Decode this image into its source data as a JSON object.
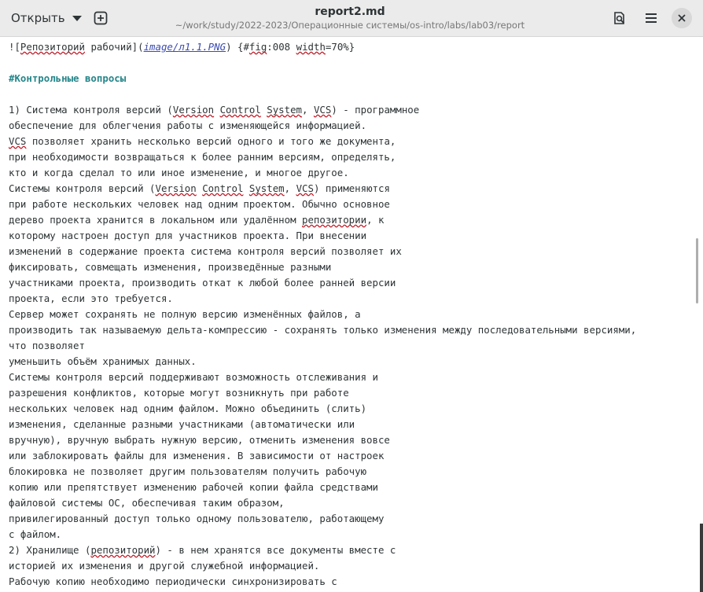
{
  "header": {
    "open_label": "Открыть",
    "new_tab_icon": "new-tab-plus-icon",
    "title": "report2.md",
    "path": "~/work/study/2022-2023/Операционные системы/os-intro/labs/lab03/report",
    "search_icon": "document-search-icon",
    "menu_icon": "hamburger-menu-icon",
    "close_icon": "close-icon"
  },
  "editor": {
    "lines": [
      {
        "segments": [
          {
            "t": "!["
          },
          {
            "t": "Репозиторий",
            "c": "sq"
          },
          {
            "t": " рабочий]("
          },
          {
            "t": "image",
            "c": "link"
          },
          {
            "t": "/",
            "c": "link"
          },
          {
            "t": "л1.1.PNG",
            "c": "link"
          },
          {
            "t": ") {#"
          },
          {
            "t": "fig",
            "c": "sq"
          },
          {
            "t": ":008 "
          },
          {
            "t": "width",
            "c": "sq"
          },
          {
            "t": "=70%}"
          }
        ]
      },
      {
        "segments": []
      },
      {
        "segments": [
          {
            "t": "#Контрольные вопросы",
            "c": "heading"
          }
        ]
      },
      {
        "segments": []
      },
      {
        "segments": [
          {
            "t": "1) Система контроля версий ("
          },
          {
            "t": "Version",
            "c": "sq"
          },
          {
            "t": " "
          },
          {
            "t": "Control",
            "c": "sq"
          },
          {
            "t": " "
          },
          {
            "t": "System",
            "c": "sq"
          },
          {
            "t": ", "
          },
          {
            "t": "VCS",
            "c": "sq"
          },
          {
            "t": ") - программное"
          }
        ]
      },
      {
        "segments": [
          {
            "t": "обеспечение для облегчения работы с изменяющейся информацией."
          }
        ]
      },
      {
        "segments": [
          {
            "t": "VCS",
            "c": "sq"
          },
          {
            "t": " позволяет хранить несколько версий одного и того же документа,"
          }
        ]
      },
      {
        "segments": [
          {
            "t": "при необходимости возвращаться к более ранним версиям, определять,"
          }
        ]
      },
      {
        "segments": [
          {
            "t": "кто и когда сделал то или иное изменение, и многое другое."
          }
        ]
      },
      {
        "segments": [
          {
            "t": "Системы контроля версий ("
          },
          {
            "t": "Version",
            "c": "sq"
          },
          {
            "t": " "
          },
          {
            "t": "Control",
            "c": "sq"
          },
          {
            "t": " "
          },
          {
            "t": "System",
            "c": "sq"
          },
          {
            "t": ", "
          },
          {
            "t": "VCS",
            "c": "sq"
          },
          {
            "t": ") применяются"
          }
        ]
      },
      {
        "segments": [
          {
            "t": "при работе нескольких человек над одним проектом. Обычно основное"
          }
        ]
      },
      {
        "segments": [
          {
            "t": "дерево проекта хранится в локальном или удалённом "
          },
          {
            "t": "репозитории",
            "c": "sq"
          },
          {
            "t": ", к"
          }
        ]
      },
      {
        "segments": [
          {
            "t": "которому настроен доступ для участников проекта. При внесении"
          }
        ]
      },
      {
        "segments": [
          {
            "t": "изменений в содержание проекта система контроля версий позволяет их"
          }
        ]
      },
      {
        "segments": [
          {
            "t": "фиксировать, совмещать изменения, произведённые разными"
          }
        ]
      },
      {
        "segments": [
          {
            "t": "участниками проекта, производить откат к любой более ранней версии"
          }
        ]
      },
      {
        "segments": [
          {
            "t": "проекта, если это требуется."
          }
        ]
      },
      {
        "segments": [
          {
            "t": "Сервер может сохранять не полную версию изменённых файлов, а"
          }
        ]
      },
      {
        "segments": [
          {
            "t": "производить так называемую дельта-компрессию - сохранять только изменения между последовательными версиями,"
          }
        ]
      },
      {
        "segments": [
          {
            "t": "что позволяет"
          }
        ]
      },
      {
        "segments": [
          {
            "t": "уменьшить объём хранимых данных."
          }
        ]
      },
      {
        "segments": [
          {
            "t": "Системы контроля версий поддерживают возможность отслеживания и"
          }
        ]
      },
      {
        "segments": [
          {
            "t": "разрешения конфликтов, которые могут возникнуть при работе"
          }
        ]
      },
      {
        "segments": [
          {
            "t": "нескольких человек над одним файлом. Можно объединить (слить)"
          }
        ]
      },
      {
        "segments": [
          {
            "t": "изменения, сделанные разными участниками (автоматически или"
          }
        ]
      },
      {
        "segments": [
          {
            "t": "вручную), вручную выбрать нужную версию, отменить изменения вовсе"
          }
        ]
      },
      {
        "segments": [
          {
            "t": "или заблокировать файлы для изменения. В зависимости от настроек"
          }
        ]
      },
      {
        "segments": [
          {
            "t": "блокировка не позволяет другим пользователям получить рабочую"
          }
        ]
      },
      {
        "segments": [
          {
            "t": "копию или препятствует изменению рабочей копии файла средствами"
          }
        ]
      },
      {
        "segments": [
          {
            "t": "файловой системы ОС, обеспечивая таким образом,"
          }
        ]
      },
      {
        "segments": [
          {
            "t": "привилегированный доступ только одному пользователю, работающему"
          }
        ]
      },
      {
        "segments": [
          {
            "t": "с файлом."
          }
        ]
      },
      {
        "segments": [
          {
            "t": "2) Хранилище ("
          },
          {
            "t": "репозиторий",
            "c": "sq"
          },
          {
            "t": ") - в нем хранятся все документы вместе с"
          }
        ]
      },
      {
        "segments": [
          {
            "t": "историей их изменения и другой служебной информацией."
          }
        ]
      },
      {
        "segments": [
          {
            "t": "Рабочую копию необходимо периодически синхронизировать с"
          }
        ]
      }
    ]
  },
  "colors": {
    "heading": "#26868a",
    "link": "#3b4bb0",
    "spellcheck": "#c01c28",
    "headerbar": "#ebebeb"
  }
}
